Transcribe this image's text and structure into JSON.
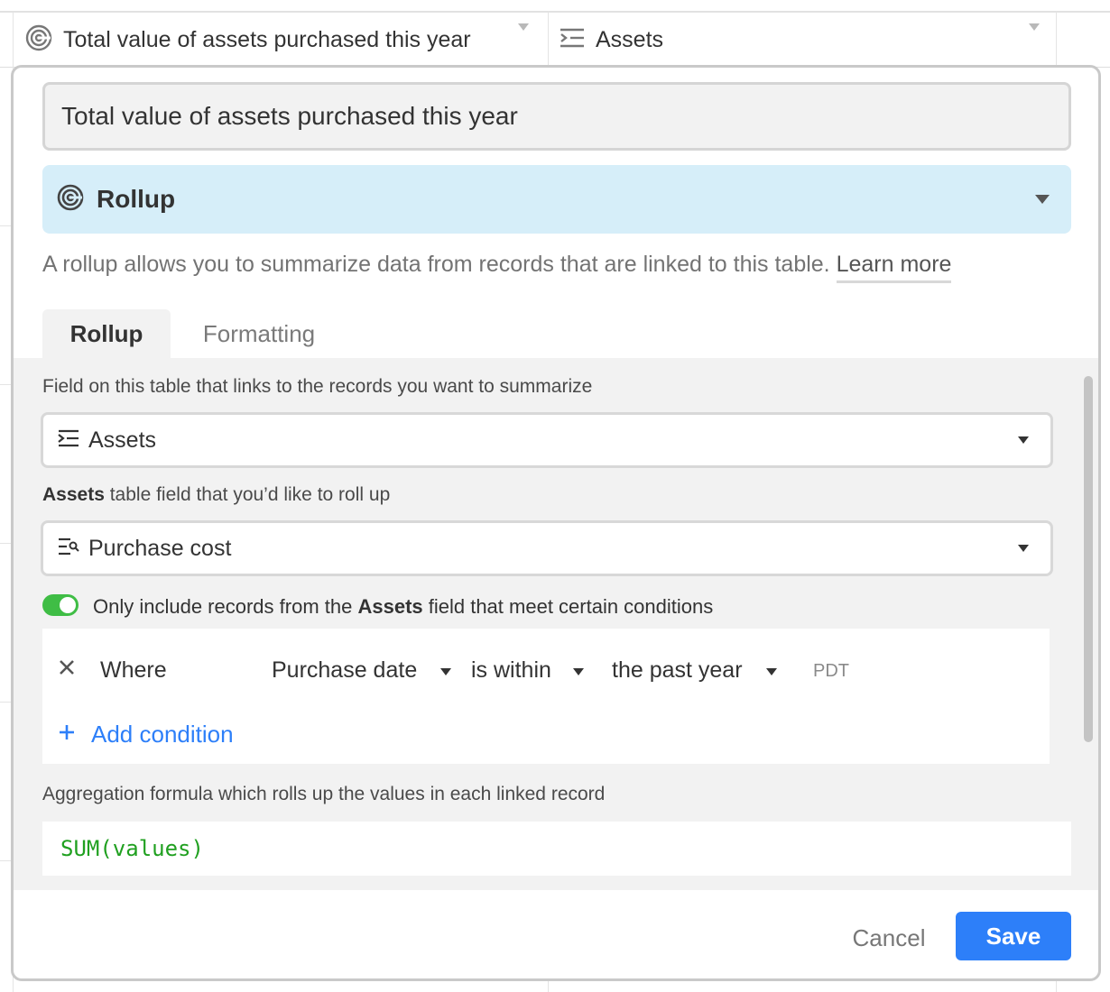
{
  "grid": {
    "columns": [
      {
        "label": "Total value of assets purchased this year",
        "icon": "rollup-spiral-icon"
      },
      {
        "label": "Assets",
        "icon": "linked-records-icon"
      }
    ]
  },
  "dialog": {
    "field_name": "Total value of assets purchased this year",
    "field_type": {
      "label": "Rollup",
      "icon": "rollup-spiral-icon"
    },
    "description": "A rollup allows you to summarize data from records that are linked to this table.",
    "learn_more": "Learn more",
    "tabs": [
      {
        "label": "Rollup",
        "active": true
      },
      {
        "label": "Formatting",
        "active": false
      }
    ],
    "link_field": {
      "label": "Field on this table that links to the records you want to summarize",
      "value": "Assets",
      "icon": "linked-records-icon"
    },
    "rollup_field": {
      "label_bold": "Assets",
      "label_rest": " table field that you’d like to roll up",
      "value": "Purchase cost",
      "icon": "lookup-icon"
    },
    "filter": {
      "enabled": true,
      "label_prefix": "Only include records from the ",
      "label_bold": "Assets",
      "label_suffix": " field that meet certain conditions",
      "conditions": [
        {
          "where": "Where",
          "field": "Purchase date",
          "operator": "is within",
          "value": "the past year",
          "timezone": "PDT"
        }
      ],
      "add_condition": "Add condition"
    },
    "aggregation": {
      "label": "Aggregation formula which rolls up the values in each linked record",
      "formula": "SUM(values)"
    },
    "buttons": {
      "cancel": "Cancel",
      "save": "Save"
    },
    "colors": {
      "accent": "#2d7ff9",
      "type_bg": "#d6eef9",
      "toggle_on": "#3fbd45",
      "formula_text": "#20a020"
    }
  }
}
